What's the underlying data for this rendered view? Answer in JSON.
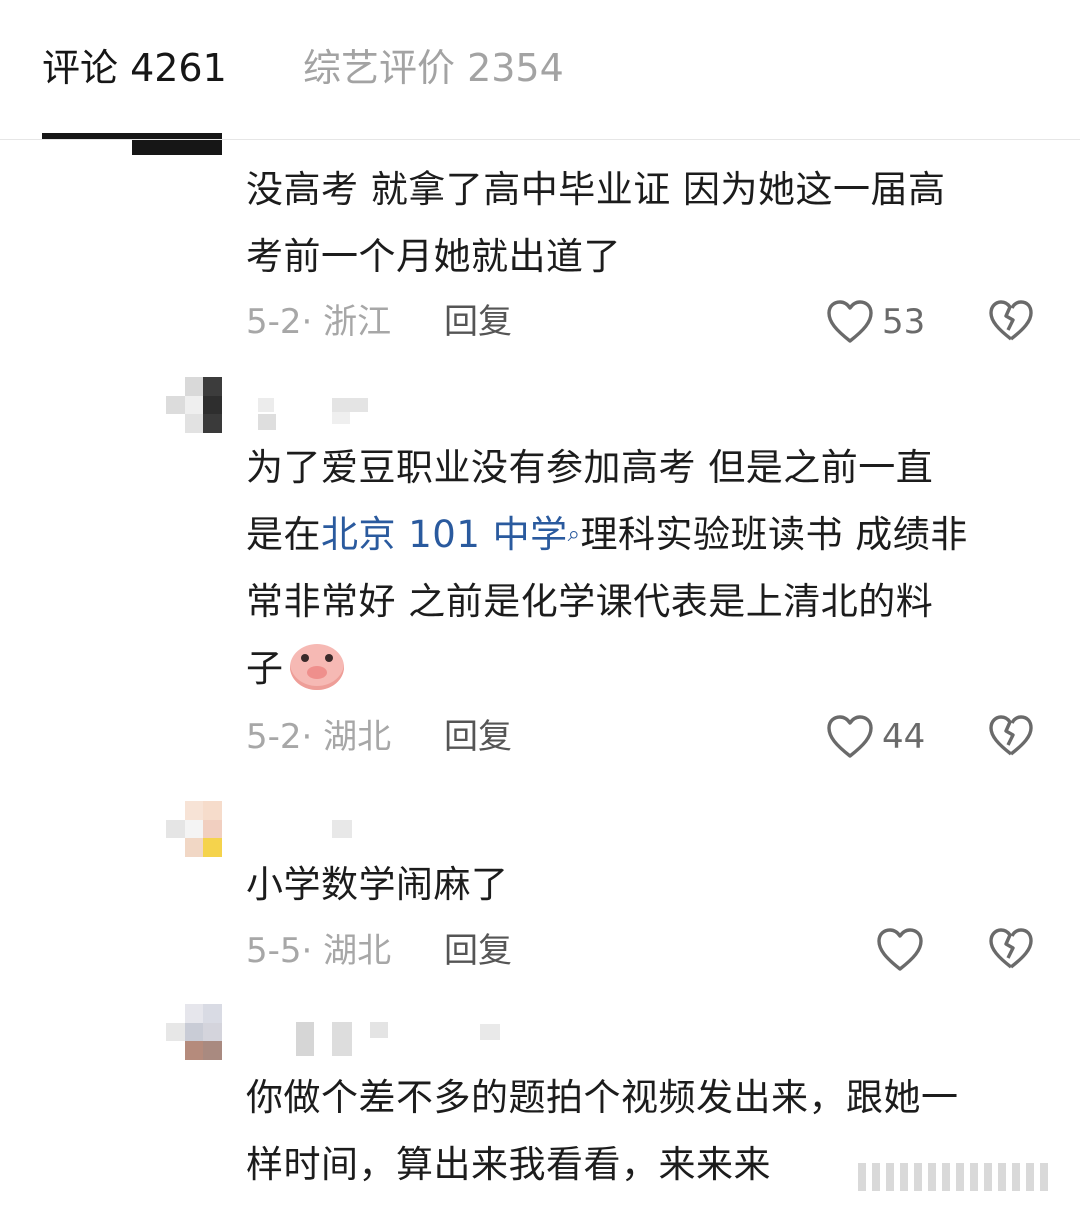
{
  "tabs": [
    {
      "label": "评论 4261",
      "active": true
    },
    {
      "label": "综艺评价 2354",
      "active": false
    }
  ],
  "comments": [
    {
      "lines": [
        "没高考 就拿了高中毕业证 因为她这一届高",
        "考前一个月她就出道了"
      ],
      "date": "5-2",
      "sep": "·",
      "region": "浙江",
      "reply_label": "回复",
      "likes": "53"
    },
    {
      "lines": [
        "为了爱豆职业没有参加高考  但是之前一直",
        "常非常好  之前是化学课代表是上清北的料",
        "子"
      ],
      "line2_before": "是在",
      "link": "北京 101 中学",
      "line2_after": "理科实验班读书  成绩非",
      "emoji": "pig-face-emoji",
      "date": "5-2",
      "sep": "·",
      "region": "湖北",
      "reply_label": "回复",
      "likes": "44"
    },
    {
      "lines": [
        "小学数学闹麻了"
      ],
      "date": "5-5",
      "sep": "·",
      "region": "湖北",
      "reply_label": "回复",
      "likes": ""
    },
    {
      "lines": [
        "你做个差不多的题拍个视频发出来，跟她一",
        "样时间，算出来我看看，来来来"
      ]
    }
  ],
  "icons": {
    "like": "heart-outline-icon",
    "dislike": "broken-heart-icon",
    "search": "search-icon"
  },
  "colors": {
    "link": "#2a5a9e",
    "meta": "#a7a7a7",
    "text": "#1c1c1c",
    "tab_inactive": "#a3a3a3"
  }
}
